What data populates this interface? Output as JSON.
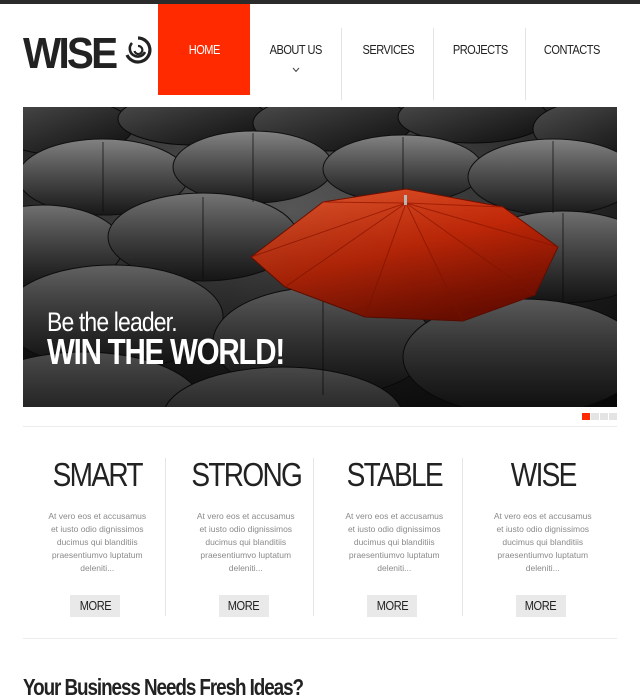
{
  "brand": {
    "logo_text": "WISE",
    "logo_icon": "swirl-logo-icon"
  },
  "nav": {
    "items": [
      {
        "label": "HOME",
        "active": true
      },
      {
        "label": "ABOUT US",
        "has_submenu": true
      },
      {
        "label": "SERVICES"
      },
      {
        "label": "PROJECTS"
      },
      {
        "label": "CONTACTS"
      }
    ]
  },
  "hero": {
    "line1": "Be the leader.",
    "line2": "WIN THE WORLD!",
    "slide_count": 4,
    "active_slide": 1
  },
  "features": [
    {
      "title": "SMART",
      "text": "At vero eos et accusamus et iusto odio dignissimos ducimus qui blanditiis praesentiumvo luptatum deleniti...",
      "button": "MORE"
    },
    {
      "title": "STRONG",
      "text": "At vero eos et accusamus et iusto odio dignissimos ducimus qui blanditiis praesentiumvo luptatum deleniti...",
      "button": "MORE"
    },
    {
      "title": "STABLE",
      "text": "At vero eos et accusamus et iusto odio dignissimos ducimus qui blanditiis praesentiumvo luptatum deleniti...",
      "button": "MORE"
    },
    {
      "title": "WISE",
      "text": "At vero eos et accusamus et iusto odio dignissimos ducimus qui blanditiis praesentiumvo luptatum deleniti...",
      "button": "MORE"
    }
  ],
  "section_heading": "Your Business Needs Fresh Ideas?",
  "colors": {
    "accent": "#ff2a00",
    "dark": "#222222",
    "muted_text": "#8a8a8a"
  }
}
